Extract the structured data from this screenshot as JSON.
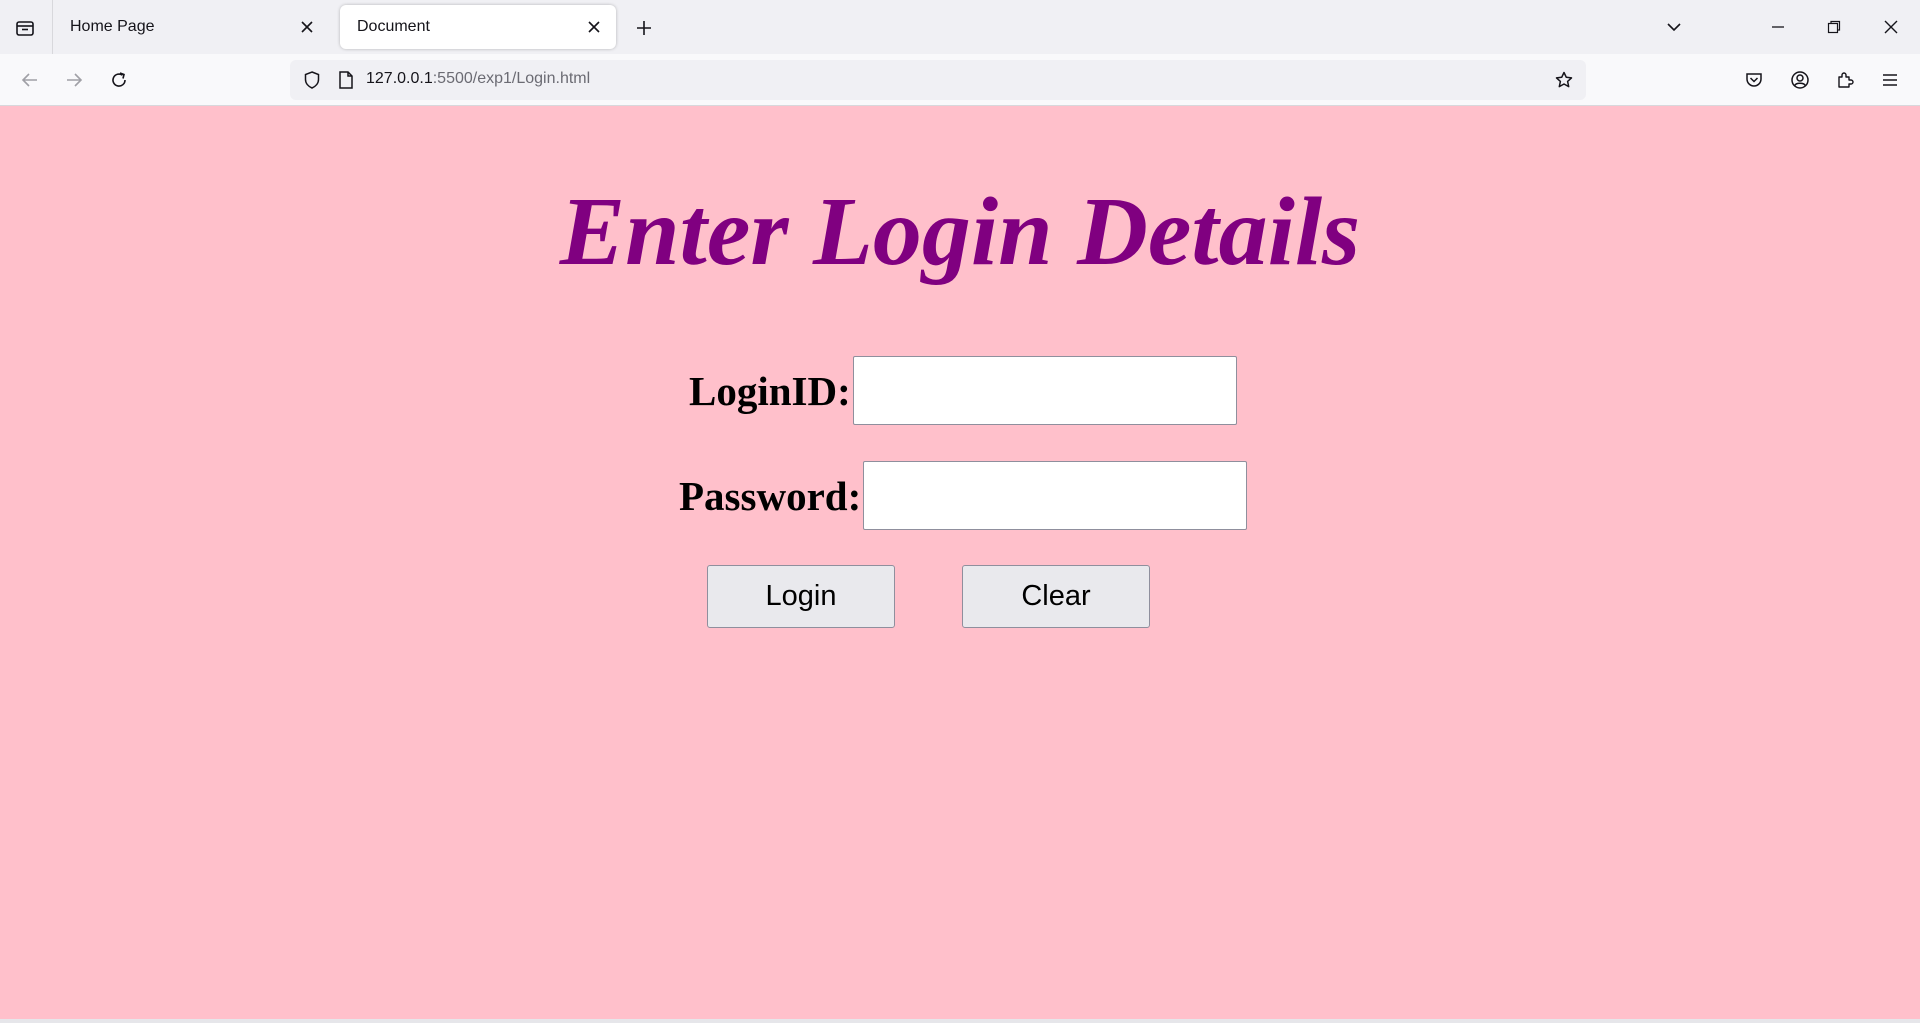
{
  "browser": {
    "tabs": [
      {
        "title": "Home Page",
        "active": false
      },
      {
        "title": "Document",
        "active": true
      }
    ],
    "url": {
      "host": "127.0.0.1",
      "rest": ":5500/exp1/Login.html"
    }
  },
  "page": {
    "background": "#ffc0cb",
    "heading": "Enter Login Details",
    "heading_color": "#800080",
    "login_label": "LoginID:",
    "login_value": "",
    "password_label": "Password:",
    "password_value": "",
    "login_button": "Login",
    "clear_button": "Clear"
  }
}
